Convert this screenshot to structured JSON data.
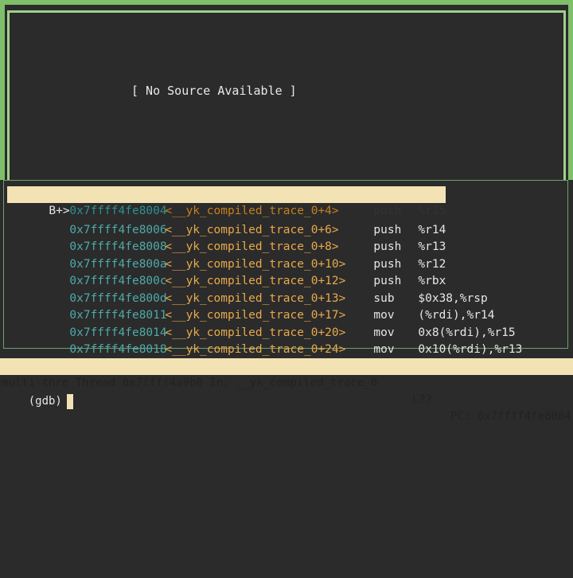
{
  "source_window": {
    "message": "[ No Source Available ]"
  },
  "asm_window": {
    "lines": [
      {
        "marker": "B+>",
        "address": "0x7ffff4fe8004",
        "symbol": "<__yk_compiled_trace_0+4>",
        "mnemonic": "push",
        "operands": "%r15"
      },
      {
        "marker": "",
        "address": "0x7ffff4fe8006",
        "symbol": "<__yk_compiled_trace_0+6>",
        "mnemonic": "push",
        "operands": "%r14"
      },
      {
        "marker": "",
        "address": "0x7ffff4fe8008",
        "symbol": "<__yk_compiled_trace_0+8>",
        "mnemonic": "push",
        "operands": "%r13"
      },
      {
        "marker": "",
        "address": "0x7ffff4fe800a",
        "symbol": "<__yk_compiled_trace_0+10>",
        "mnemonic": "push",
        "operands": "%r12"
      },
      {
        "marker": "",
        "address": "0x7ffff4fe800c",
        "symbol": "<__yk_compiled_trace_0+12>",
        "mnemonic": "push",
        "operands": "%rbx"
      },
      {
        "marker": "",
        "address": "0x7ffff4fe800d",
        "symbol": "<__yk_compiled_trace_0+13>",
        "mnemonic": "sub",
        "operands": "$0x38,%rsp"
      },
      {
        "marker": "",
        "address": "0x7ffff4fe8011",
        "symbol": "<__yk_compiled_trace_0+17>",
        "mnemonic": "mov",
        "operands": "(%rdi),%r14"
      },
      {
        "marker": "",
        "address": "0x7ffff4fe8014",
        "symbol": "<__yk_compiled_trace_0+20>",
        "mnemonic": "mov",
        "operands": "0x8(%rdi),%r15"
      },
      {
        "marker": "",
        "address": "0x7ffff4fe8018",
        "symbol": "<__yk_compiled_trace_0+24>",
        "mnemonic": "mov",
        "operands": "0x10(%rdi),%r13"
      }
    ]
  },
  "status_bar": {
    "target": "multi-thre Thread 0x7ffff4a9b0 In: __yk_compiled_trace_0",
    "line": "L??",
    "pc": "PC: 0x7ffff4fe8004"
  },
  "command": {
    "prompt": "(gdb)"
  },
  "colors": {
    "border_green": "#7fbf6a",
    "highlight": "#f2e2b4",
    "address": "#4faaaa",
    "symbol": "#e8a94a",
    "background": "#2b2b2b"
  }
}
